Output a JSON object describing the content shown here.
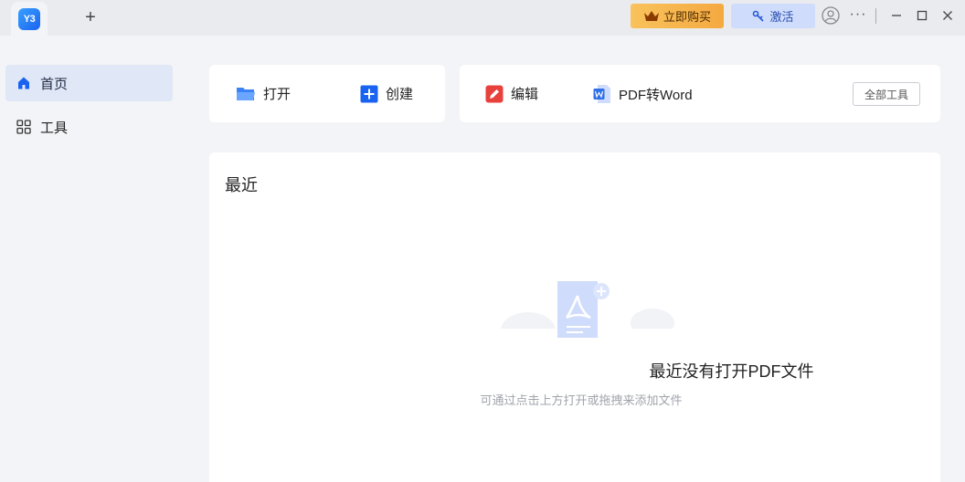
{
  "app": {
    "logo_text": "Y3"
  },
  "titlebar": {
    "new_tab": "+",
    "buy_label": "立即购买",
    "activate_label": "激活",
    "more_label": "···"
  },
  "sidebar": {
    "items": [
      {
        "label": "首页",
        "icon": "home-icon",
        "active": true
      },
      {
        "label": "工具",
        "icon": "grid-icon",
        "active": false
      }
    ]
  },
  "quick_actions": {
    "open_label": "打开",
    "create_label": "创建",
    "edit_label": "编辑",
    "pdf_to_word_label": "PDF转Word",
    "all_tools_label": "全部工具"
  },
  "recent": {
    "title": "最近",
    "empty_title": "最近没有打开PDF文件",
    "empty_subtitle": "可通过点击上方打开或拖拽来添加文件"
  },
  "colors": {
    "accent": "#1a63f0",
    "buy": "#f5a940",
    "activate_bg": "#cfdcfb",
    "edit_red": "#e8413c"
  }
}
